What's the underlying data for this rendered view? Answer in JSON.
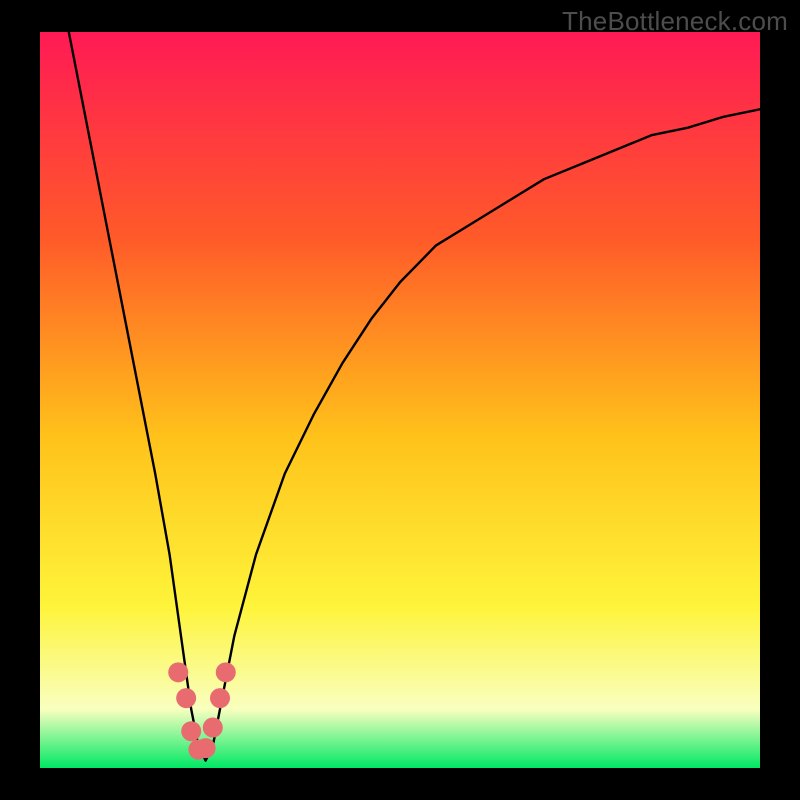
{
  "watermark": "TheBottleneck.com",
  "colors": {
    "gradient_top": "#ff1a55",
    "gradient_mid_upper": "#ff5a29",
    "gradient_mid": "#ffc21a",
    "gradient_mid_lower": "#fef43a",
    "gradient_pale": "#f9ffbf",
    "gradient_bottom": "#00e865",
    "curve": "#000000",
    "marker": "#e86b6f",
    "frame": "#000000"
  },
  "chart_data": {
    "type": "line",
    "title": "",
    "xlabel": "",
    "ylabel": "",
    "xlim": [
      0,
      100
    ],
    "ylim": [
      0,
      100
    ],
    "grid": false,
    "legend": false,
    "series": [
      {
        "name": "bottleneck-curve",
        "x": [
          4,
          6,
          8,
          10,
          12,
          14,
          16,
          18,
          19,
          20,
          21,
          22,
          23,
          24,
          25,
          27,
          30,
          34,
          38,
          42,
          46,
          50,
          55,
          60,
          65,
          70,
          75,
          80,
          85,
          90,
          95,
          100
        ],
        "y": [
          100,
          90,
          80,
          70,
          60,
          50,
          40,
          29,
          22,
          15,
          8,
          3,
          1,
          3,
          8,
          18,
          29,
          40,
          48,
          55,
          61,
          66,
          71,
          74,
          77,
          80,
          82,
          84,
          86,
          87,
          88.5,
          89.5
        ]
      }
    ],
    "markers": {
      "name": "highlight-points",
      "x": [
        19.2,
        20.3,
        21.0,
        22.0,
        23.0,
        24.0,
        25.0,
        25.8
      ],
      "y": [
        13.0,
        9.5,
        5.0,
        2.5,
        2.7,
        5.5,
        9.5,
        13.0
      ]
    }
  }
}
